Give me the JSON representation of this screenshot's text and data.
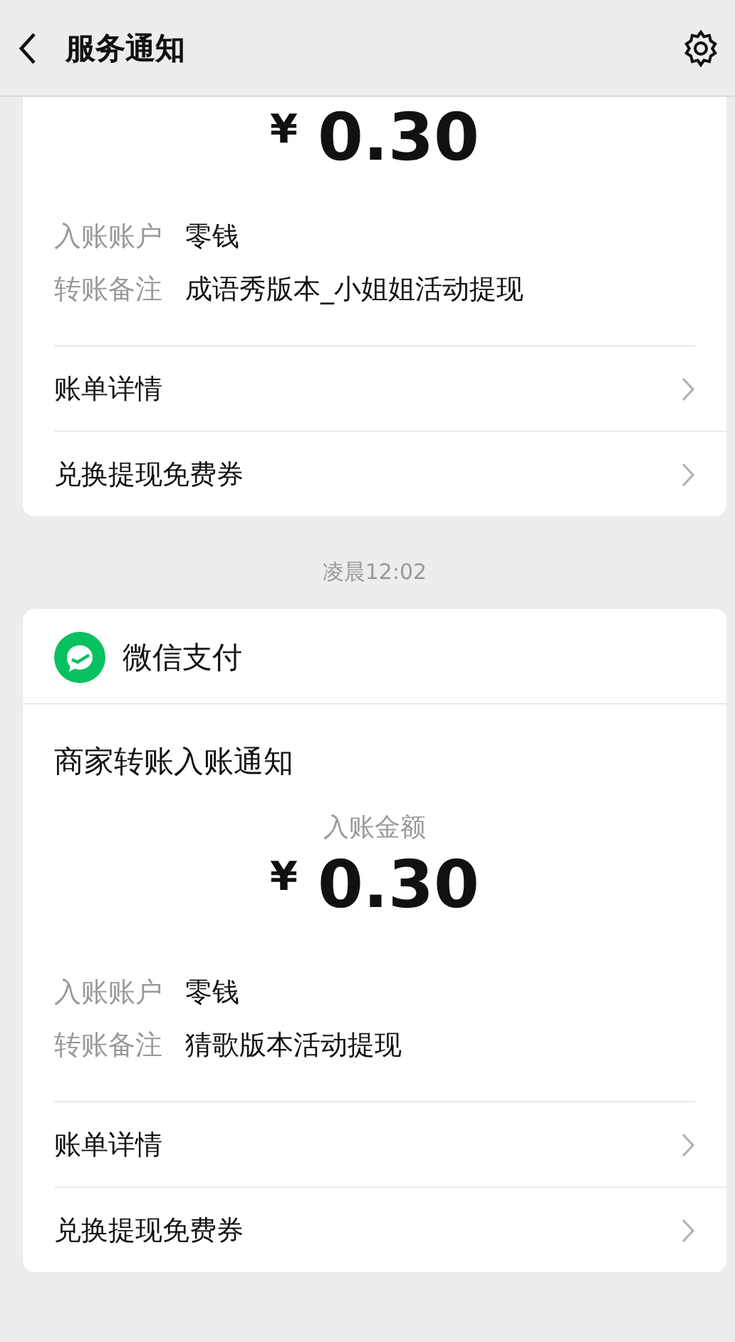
{
  "header": {
    "title": "服务通知"
  },
  "messages": [
    {
      "kind": "partial",
      "amount_symbol": "¥",
      "amount": "0.30",
      "fields": [
        {
          "label": "入账账户",
          "value": "零钱"
        },
        {
          "label": "转账备注",
          "value": "成语秀版本_小姐姐活动提现"
        }
      ],
      "links": [
        "账单详情",
        "兑换提现免费券"
      ]
    },
    {
      "kind": "full",
      "time": "凌晨12:02",
      "source": "微信支付",
      "heading": "商家转账入账通知",
      "amount_label": "入账金额",
      "amount_symbol": "¥",
      "amount": "0.30",
      "fields": [
        {
          "label": "入账账户",
          "value": "零钱"
        },
        {
          "label": "转账备注",
          "value": "猜歌版本活动提现"
        }
      ],
      "links": [
        "账单详情",
        "兑换提现免费券"
      ]
    }
  ]
}
